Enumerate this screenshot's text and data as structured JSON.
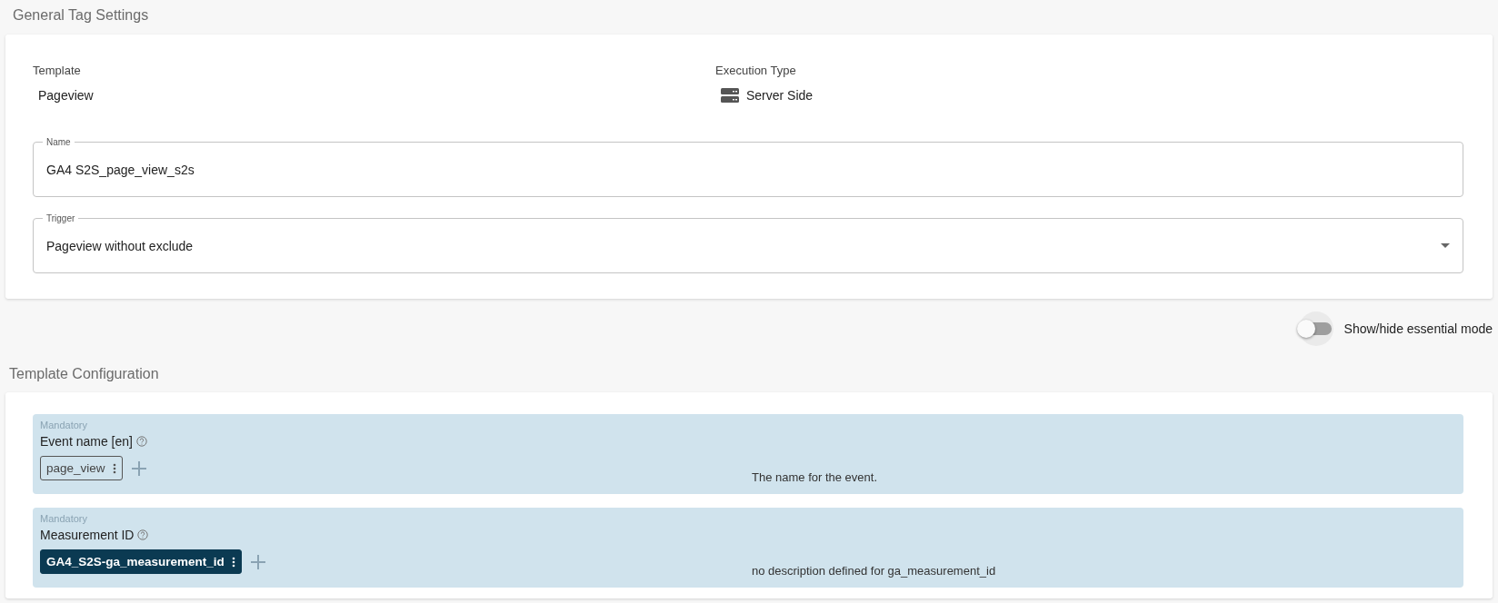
{
  "general_tag_settings": {
    "title": "General Tag Settings",
    "template": {
      "label": "Template",
      "value": "Pageview"
    },
    "execution_type": {
      "label": "Execution Type",
      "value": "Server Side"
    },
    "name_field": {
      "label": "Name",
      "value": "GA4 S2S_page_view_s2s"
    },
    "trigger_field": {
      "label": "Trigger",
      "value": "Pageview without exclude"
    }
  },
  "essential_mode_toggle": {
    "label": "Show/hide essential mode",
    "on": false
  },
  "template_configuration": {
    "title": "Template Configuration",
    "parameters": [
      {
        "badge": "Mandatory",
        "label": "Event name [en]",
        "chip": {
          "kind": "constant",
          "text": "page_view"
        },
        "description": "The name for the event."
      },
      {
        "badge": "Mandatory",
        "label": "Measurement ID",
        "chip": {
          "kind": "variable",
          "text": "GA4_S2S-ga_measurement_id"
        },
        "description": "no description defined for ga_measurement_id"
      }
    ]
  }
}
